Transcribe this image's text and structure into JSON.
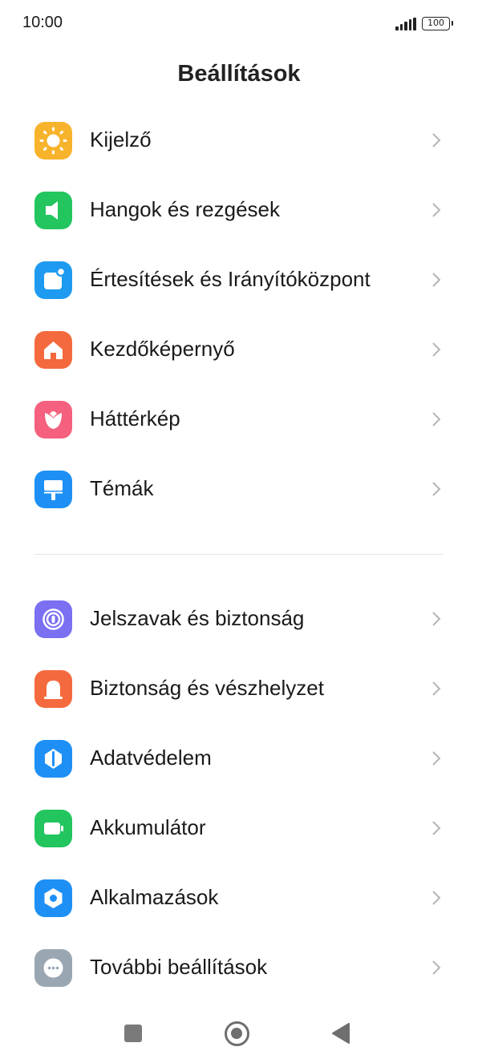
{
  "status_bar": {
    "time": "10:00",
    "battery": "100",
    "signal_icon": "signal-bars-icon"
  },
  "header": {
    "title": "Beállítások"
  },
  "groups": [
    {
      "items": [
        {
          "label": "Kijelző",
          "icon": "sun-icon",
          "color": "#F8B32C"
        },
        {
          "label": "Hangok és rezgések",
          "icon": "speaker-icon",
          "color": "#22C55E"
        },
        {
          "label": "Értesítések és Irányítóközpont",
          "icon": "notification-icon",
          "color": "#1E9BF0"
        },
        {
          "label": "Kezdőképernyő",
          "icon": "home-icon",
          "color": "#F46A3E"
        },
        {
          "label": "Háttérkép",
          "icon": "tulip-icon",
          "color": "#F4607E"
        },
        {
          "label": "Témák",
          "icon": "paint-roller-icon",
          "color": "#1E90F5"
        }
      ]
    },
    {
      "items": [
        {
          "label": "Jelszavak és biztonság",
          "icon": "password-icon",
          "color": "#7B6FF2"
        },
        {
          "label": "Biztonság és vészhelyzet",
          "icon": "emergency-icon",
          "color": "#F46A3E"
        },
        {
          "label": "Adatvédelem",
          "icon": "privacy-icon",
          "color": "#1E90F5"
        },
        {
          "label": "Akkumulátor",
          "icon": "battery-icon",
          "color": "#22C55E"
        },
        {
          "label": "Alkalmazások",
          "icon": "gear-icon",
          "color": "#1E90F5"
        },
        {
          "label": "További beállítások",
          "icon": "more-icon",
          "color": "#9BA6B3"
        }
      ]
    }
  ],
  "nav_bar": {
    "recents_icon": "recents-square-icon",
    "home_icon": "home-circle-icon",
    "back_icon": "back-triangle-icon"
  }
}
